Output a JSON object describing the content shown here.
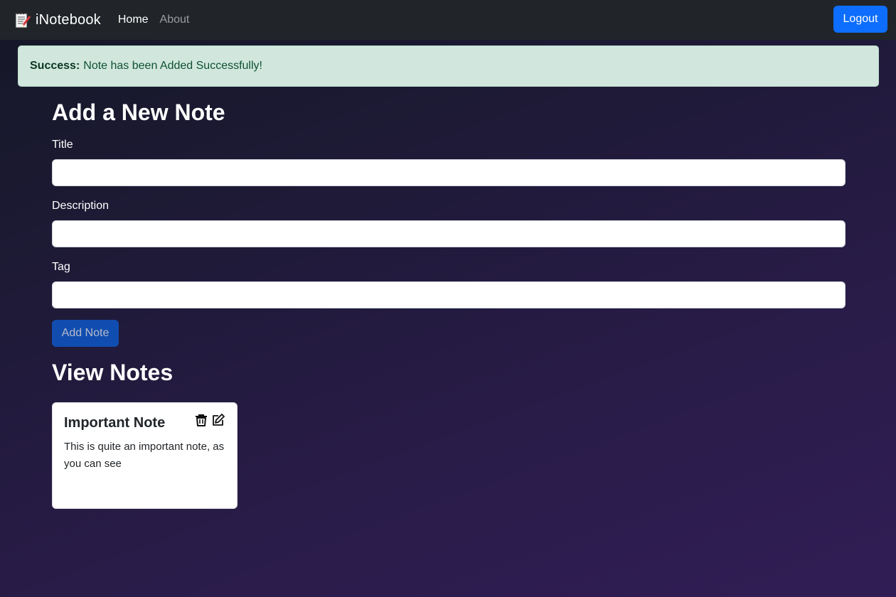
{
  "navbar": {
    "brand": "iNotebook",
    "brand_icon": "notebook-icon",
    "links": [
      {
        "label": "Home",
        "active": true
      },
      {
        "label": "About",
        "active": false
      }
    ],
    "logout_label": "Logout"
  },
  "alert": {
    "type": "Success:",
    "message": "Note has been Added Successfully!"
  },
  "form": {
    "heading": "Add a New Note",
    "title_label": "Title",
    "title_value": "",
    "description_label": "Description",
    "description_value": "",
    "tag_label": "Tag",
    "tag_value": "",
    "submit_label": "Add Note"
  },
  "notes_section": {
    "heading": "View Notes",
    "notes": [
      {
        "title": "Important Note",
        "description": "This is quite an important note, as you can see",
        "icons": [
          "trash-icon",
          "edit-icon"
        ]
      }
    ]
  },
  "colors": {
    "navbar_bg": "#212529",
    "primary": "#0d6efd",
    "alert_bg": "#d1e7dd",
    "alert_text": "#0f5132"
  }
}
